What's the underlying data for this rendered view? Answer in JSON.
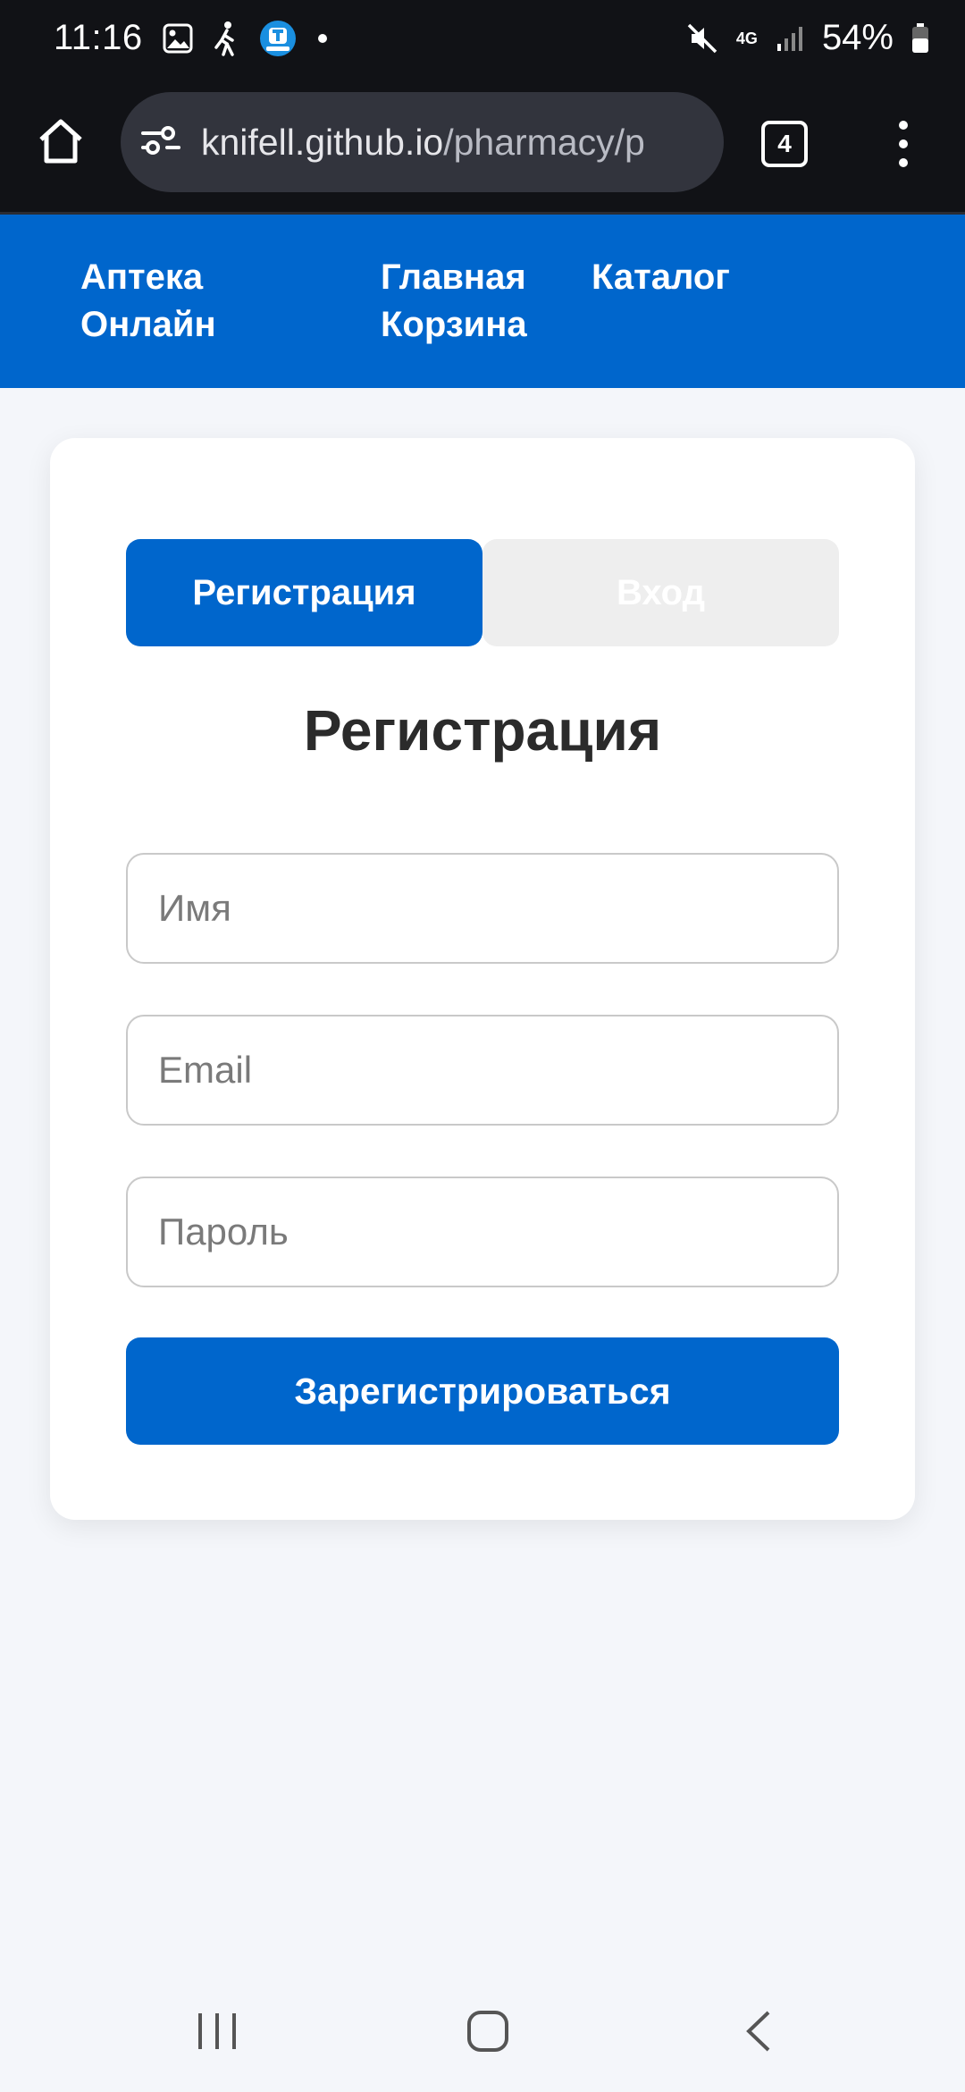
{
  "status_bar": {
    "time": "11:16",
    "battery": "54%",
    "network": "4G",
    "icons": [
      "gallery-icon",
      "walking-icon",
      "app-badge-icon",
      "dot-icon",
      "mute-icon",
      "network-4g-icon",
      "signal-icon",
      "battery-icon"
    ]
  },
  "browser": {
    "url_host": "knifell.github.io",
    "url_path": "/pharmacy/p",
    "tab_count": "4"
  },
  "header": {
    "brand_line1": "Аптека",
    "brand_line2": "Онлайн",
    "nav_home": "Главная",
    "nav_cart": "Корзина",
    "nav_catalog": "Каталог"
  },
  "auth": {
    "tab_register": "Регистрация",
    "tab_login": "Вход",
    "title": "Регистрация",
    "name_placeholder": "Имя",
    "email_placeholder": "Email",
    "password_placeholder": "Пароль",
    "submit_label": "Зарегистрироваться"
  },
  "colors": {
    "primary": "#0066cc",
    "background": "#f4f6fa",
    "system_bar": "#111216"
  }
}
